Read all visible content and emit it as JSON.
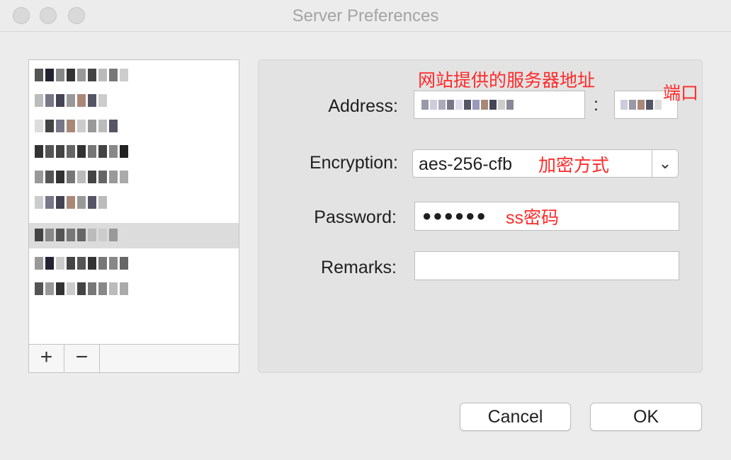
{
  "window": {
    "title": "Server Preferences"
  },
  "server_list": {
    "items_count_note": "",
    "add_label": "+",
    "remove_label": "−"
  },
  "form": {
    "address_label": "Address:",
    "port_separator": ":",
    "encryption_label": "Encryption:",
    "encryption_value": "aes-256-cfb",
    "password_label": "Password:",
    "password_value": "●●●●●●",
    "remarks_label": "Remarks:",
    "remarks_value": ""
  },
  "annotations": {
    "address_note": "网站提供的服务器地址",
    "port_note": "端口",
    "encryption_note": "加密方式",
    "password_note": "ss密码"
  },
  "buttons": {
    "cancel": "Cancel",
    "ok": "OK"
  },
  "colors": {
    "annotation": "#ff2a2a",
    "selected_row": "#dcdcdc",
    "panel_bg": "#e3e3e3"
  },
  "icons": {
    "add": "plus-icon",
    "remove": "minus-icon",
    "dropdown": "chevron-down-icon"
  }
}
